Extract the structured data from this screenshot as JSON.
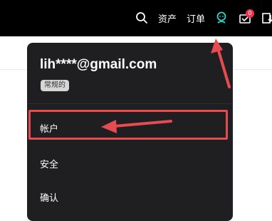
{
  "header": {
    "assets_label": "资产",
    "orders_label": "订单",
    "notification_count": "0"
  },
  "account_menu": {
    "email": "lih****@gmail.com",
    "account_type": "常规的",
    "items": [
      {
        "label": "帐户"
      },
      {
        "label": "安全"
      },
      {
        "label": "确认"
      }
    ]
  },
  "colors": {
    "header_bg": "#000000",
    "menu_bg": "#1f1f22",
    "profile_icon": "#2bd3c8",
    "badge": "#f0334a",
    "annotation": "#e64b4f"
  }
}
